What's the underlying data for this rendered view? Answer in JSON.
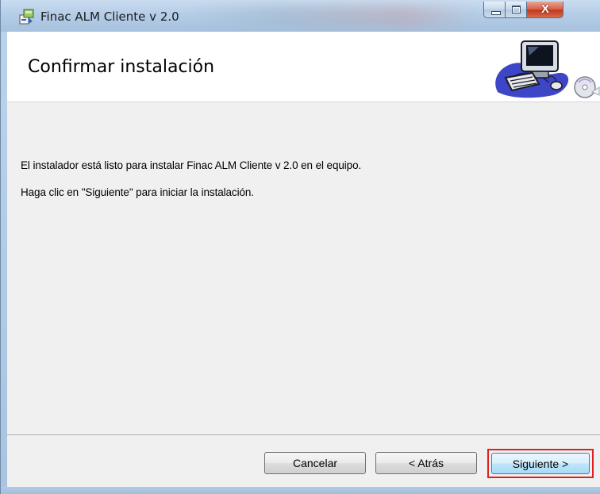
{
  "window": {
    "title": "Finac ALM Cliente v 2.0",
    "close_symbol": "X"
  },
  "header": {
    "title": "Confirmar instalación",
    "art_icon": "computer-setup-icon"
  },
  "content": {
    "line1": "El instalador está listo para instalar Finac ALM Cliente v 2.0 en el equipo.",
    "line2": "Haga clic en \"Siguiente\" para iniciar la instalación."
  },
  "buttons": {
    "cancel": "Cancelar",
    "back": "< Atrás",
    "next": "Siguiente >"
  },
  "colors": {
    "highlight": "#e02020",
    "titlebar": "#b5cde7"
  }
}
